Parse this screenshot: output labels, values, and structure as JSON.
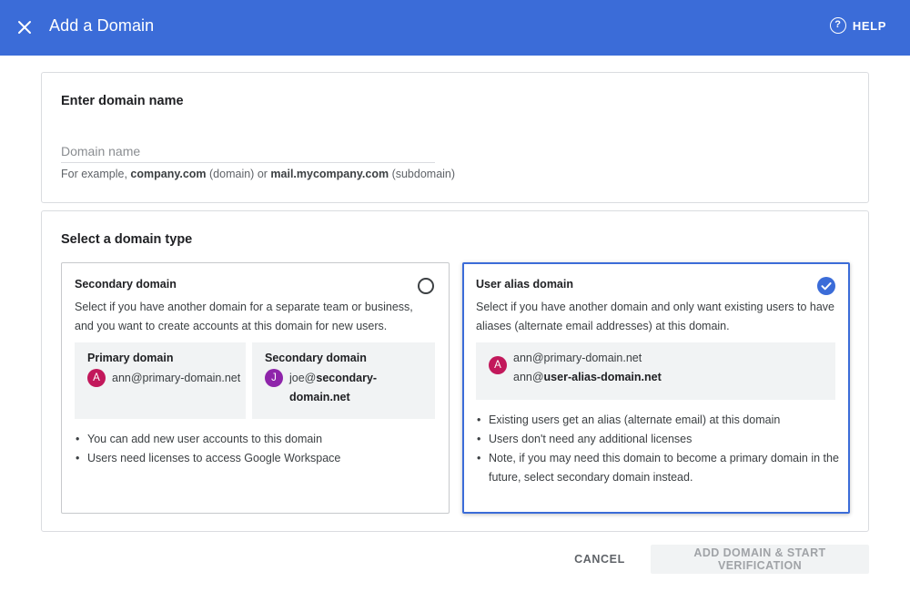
{
  "header": {
    "close_icon": "close-icon",
    "title": "Add a Domain",
    "help_icon": "?",
    "help_label": "HELP"
  },
  "domain_name_card": {
    "title": "Enter domain name",
    "input_placeholder": "Domain name",
    "input_value": "",
    "hint": {
      "prefix": "For example, ",
      "example1": "company.com",
      "mid1": " (domain) or ",
      "example2": "mail.mycompany.com",
      "suffix": " (subdomain)"
    }
  },
  "domain_type_card": {
    "title": "Select a domain type",
    "options": [
      {
        "title": "Secondary domain",
        "selected": false,
        "description": "Select if you have another domain for a separate team or business, and you want to create accounts at this domain for new users.",
        "examples": [
          {
            "title": "Primary domain",
            "avatar": "A",
            "email_plain": "ann@primary-domain.net",
            "email_bold": ""
          },
          {
            "title": "Secondary domain",
            "avatar": "J",
            "email_plain": "joe@",
            "email_bold": "secondary-domain.net"
          }
        ],
        "bullets": [
          "You can add new user accounts to this domain",
          "Users need licenses to access Google Workspace"
        ]
      },
      {
        "title": "User alias domain",
        "selected": true,
        "description": "Select if you have another domain and only want existing users to have aliases (alternate email addresses) at this domain.",
        "example": {
          "avatar": "A",
          "email_line1": "ann@primary-domain.net",
          "email_line2_plain": "ann@",
          "email_line2_bold": "user-alias-domain.net"
        },
        "bullets": [
          "Existing users get an alias (alternate email) at this domain",
          "Users don't need any additional licenses",
          "Note, if you may need this domain to become a primary domain in the future, select secondary domain instead."
        ]
      }
    ]
  },
  "footer": {
    "cancel_label": "CANCEL",
    "add_label": "ADD DOMAIN & START VERIFICATION"
  },
  "colors": {
    "header_bg": "#3b6cd8",
    "selected_border": "#3b6cd8",
    "avatar_a": "#c2185b",
    "avatar_j": "#8e24aa"
  }
}
